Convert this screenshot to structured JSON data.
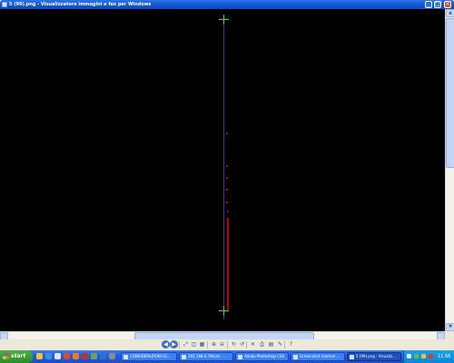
{
  "window": {
    "title": "5 (99).png - Visualizzatore immagini e fax per Windows",
    "minimize_glyph": "_",
    "maximize_glyph": "□",
    "close_glyph": "×"
  },
  "scrollbar": {
    "up_glyph": "▲",
    "down_glyph": "▼"
  },
  "toolbar": {
    "tools": [
      {
        "name": "previous-image-icon",
        "glyph": "◀"
      },
      {
        "name": "next-image-icon",
        "glyph": "▶"
      },
      {
        "name": "best-fit-icon",
        "glyph": "⤢"
      },
      {
        "name": "actual-size-icon",
        "glyph": "◫"
      },
      {
        "name": "slideshow-icon",
        "glyph": "▦"
      },
      {
        "name": "zoom-in-icon",
        "glyph": "⊕"
      },
      {
        "name": "zoom-out-icon",
        "glyph": "⊖"
      },
      {
        "name": "rotate-clockwise-icon",
        "glyph": "↻"
      },
      {
        "name": "rotate-counterclockwise-icon",
        "glyph": "↺"
      },
      {
        "name": "delete-icon",
        "glyph": "✕"
      },
      {
        "name": "print-icon",
        "glyph": "⎙"
      },
      {
        "name": "copy-to-icon",
        "glyph": "▤"
      },
      {
        "name": "open-for-editing-icon",
        "glyph": "✎"
      },
      {
        "name": "help-icon",
        "glyph": "?"
      }
    ]
  },
  "taskbar": {
    "start_label": "start",
    "tasks": [
      {
        "label": "CONSIDERAZIONI SC...",
        "active": false
      },
      {
        "label": "192.168.0.78/cali - ...",
        "active": false
      },
      {
        "label": "Adobe Photoshop CS4",
        "active": false
      },
      {
        "label": "Screenshot scanner ...",
        "active": false
      },
      {
        "label": "5 (99).png - Visualiz...",
        "active": true
      }
    ],
    "clock": "11.56"
  }
}
